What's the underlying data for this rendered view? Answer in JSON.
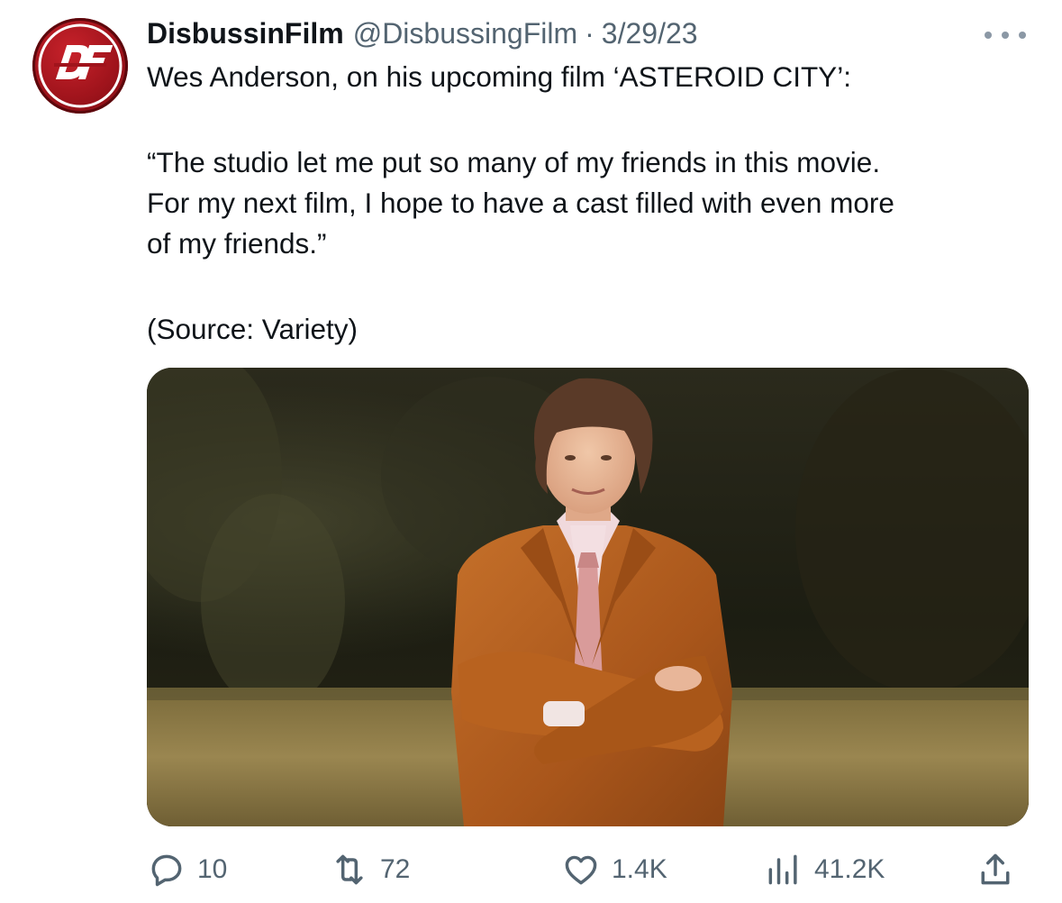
{
  "tweet": {
    "author": {
      "display_name": "DisbussinFilm",
      "handle": "@DisbussingFilm",
      "avatar_text": "DF"
    },
    "separator": "·",
    "date": "3/29/23",
    "text_lines": [
      "Wes Anderson, on his upcoming film ‘ASTEROID CITY’:",
      "“The studio let me put so many of my friends in this movie.",
      "For my next film, I hope to have a cast filled with even more",
      "of my friends.”",
      "(Source: Variety)"
    ],
    "media": {
      "kind": "photo",
      "subject": "man in an orange corduroy suit with arms crossed standing in a grassy field"
    },
    "metrics": {
      "replies": "10",
      "retweets": "72",
      "likes": "1.4K",
      "views": "41.2K"
    }
  },
  "icons": {
    "more": "more-horizontal-icon",
    "reply": "reply-bubble-icon",
    "retweet": "retweet-icon",
    "like": "heart-icon",
    "views": "views-bar-chart-icon",
    "share": "share-upload-icon"
  },
  "colors": {
    "text_primary": "#0f1419",
    "text_secondary": "#536471",
    "avatar_red": "#a0141c",
    "suit_orange": "#b5621f"
  }
}
